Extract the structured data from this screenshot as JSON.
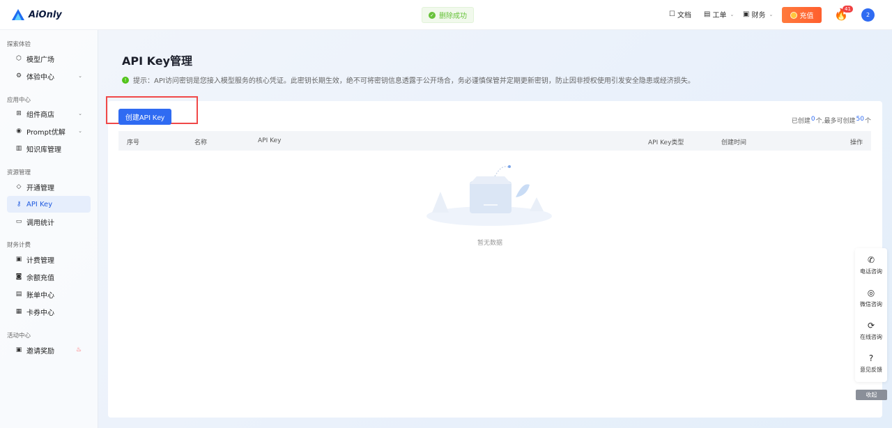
{
  "app": {
    "name": "AiOnly"
  },
  "toast": {
    "text": "删除成功"
  },
  "topnav": {
    "docs": "文档",
    "ticket": "工单",
    "finance": "财务",
    "recharge": "充值",
    "fire_badge": "41",
    "avatar_text": "2"
  },
  "sidebar": {
    "groups": [
      "探索体验",
      "应用中心",
      "资源管理",
      "财务计费",
      "活动中心"
    ],
    "items": [
      {
        "label": "模型广场",
        "icon": "cube-icon"
      },
      {
        "label": "体验中心",
        "icon": "gear-icon"
      },
      {
        "label": "组件商店",
        "icon": "store-icon"
      },
      {
        "label": "Prompt优解",
        "icon": "bulb-icon"
      },
      {
        "label": "知识库管理",
        "icon": "book-icon"
      },
      {
        "label": "开通管理",
        "icon": "diamond-icon"
      },
      {
        "label": "API Key",
        "icon": "key-icon"
      },
      {
        "label": "调用统计",
        "icon": "chart-icon"
      },
      {
        "label": "计费管理",
        "icon": "doc-icon"
      },
      {
        "label": "余额充值",
        "icon": "wallet-icon"
      },
      {
        "label": "账单中心",
        "icon": "bill-icon"
      },
      {
        "label": "卡券中心",
        "icon": "ticket-icon"
      },
      {
        "label": "邀请奖励",
        "icon": "gift-icon"
      }
    ],
    "active": "API Key"
  },
  "main": {
    "title": "API Key管理",
    "tip": "提示：API访问密钥是您接入模型服务的核心凭证。此密钥长期生效，绝不可将密钥信息透露于公开场合，务必谨慎保管并定期更新密钥，防止因非授权使用引发安全隐患或经济损失。",
    "create_button": "创建API Key",
    "quota": {
      "prefix": "已创建",
      "created": "0",
      "mid": "个,最多可创建",
      "max": "50",
      "suffix": "个"
    },
    "table": {
      "columns": [
        "序号",
        "名称",
        "API Key",
        "API Key类型",
        "创建时间",
        "操作"
      ],
      "rows": [],
      "empty_text": "暂无数据"
    }
  },
  "float_panel": {
    "items": [
      "电话咨询",
      "微信咨询",
      "在线咨询",
      "意见反馈"
    ],
    "collapse": "收起"
  },
  "colors": {
    "accent": "#2f6bf2",
    "recharge": "#ff6a35",
    "success": "#67c23a",
    "highlight": "#f04848"
  }
}
